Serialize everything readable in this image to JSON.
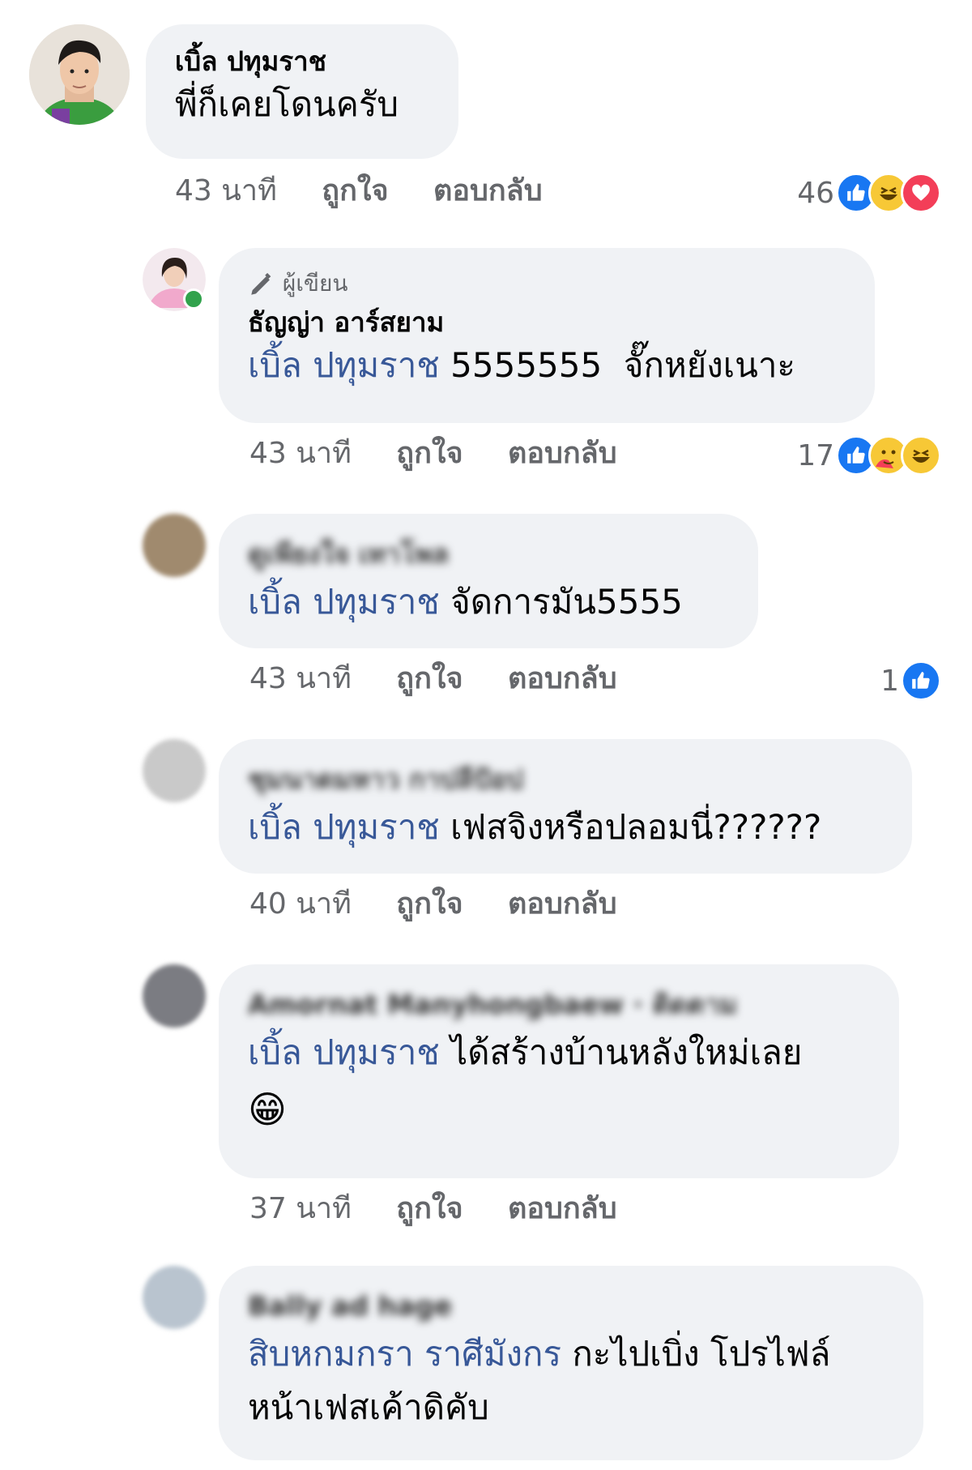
{
  "comments": [
    {
      "author": "เบิ้ล ปทุมราช",
      "text": "พี่ก็เคยโดนครับ",
      "time": "43 นาที",
      "like": "ถูกใจ",
      "reply": "ตอบกลับ",
      "reaction_count": "46",
      "reactions": [
        "like-icon",
        "haha-icon",
        "love-icon"
      ]
    },
    {
      "badge": "ผู้เขียน",
      "author": "ธัญญ่า อาร์สยาม",
      "mention": "เบิ้ล ปทุมราช",
      "text": "5555555  จั๊กหยังเนาะ",
      "time": "43 นาที",
      "like": "ถูกใจ",
      "reply": "ตอบกลับ",
      "reaction_count": "17",
      "reactions": [
        "like-icon",
        "care-icon",
        "haha-icon"
      ]
    },
    {
      "author": "ดูเพียงใจ เทาโพล",
      "mention": "เบิ้ล ปทุมราช",
      "text": "จัดการมัน5555",
      "time": "43 นาที",
      "like": "ถูกใจ",
      "reply": "ตอบกลับ",
      "reaction_count": "1",
      "reactions": [
        "like-icon"
      ]
    },
    {
      "author": "ชุมนาดมหาว กาปลีปัอป",
      "mention": "เบิ้ล ปทุมราช",
      "text": "เฟสจิงหรือปลอมนี่??????",
      "time": "40 นาที",
      "like": "ถูกใจ",
      "reply": "ตอบกลับ"
    },
    {
      "author": "Amornat Manyhongbaew · ติดตาม",
      "mention": "เบิ้ล ปทุมราช",
      "text": "ได้สร้างบ้านหลังใหม่เลย",
      "emoji": "😁",
      "time": "37 นาที",
      "like": "ถูกใจ",
      "reply": "ตอบกลับ"
    },
    {
      "author": "Bally ad hage",
      "mention": "สิบหกมกรา ราศีมังกร",
      "text": "กะไปเบิ่ง โปรไฟล์",
      "text2": "หน้าเฟสเค้าดิคับ"
    }
  ],
  "colors": {
    "mention": "#385898",
    "bubble": "#f0f2f5",
    "meta": "#65676b",
    "like_blue": "#1877f2"
  }
}
